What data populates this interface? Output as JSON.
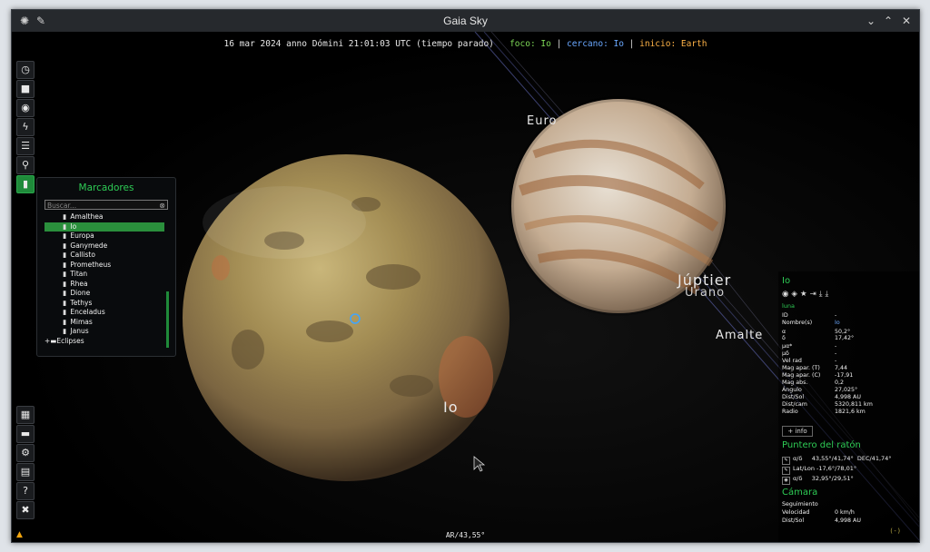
{
  "window": {
    "title": "Gaia Sky"
  },
  "topinfo": {
    "datetime": "16 mar 2024 anno Dómini 21:01:03 UTC (tiempo parado)",
    "focus_label": "foco: Io",
    "closest_label": "cercano: Io",
    "home_label": "inicio: Earth"
  },
  "toolbar": {
    "icons": [
      "clock-icon",
      "camera-icon",
      "eye-icon",
      "lightning-icon",
      "layers-icon",
      "location-pin-icon",
      "bookmark-icon"
    ],
    "bottom_icons": [
      "map-icon",
      "folder-icon",
      "gear-icon",
      "log-icon",
      "help-icon",
      "close-icon"
    ]
  },
  "bookmarks": {
    "title": "Marcadores",
    "search_placeholder": "Buscar...",
    "items": [
      "Amalthea",
      "Io",
      "Europa",
      "Ganymede",
      "Callisto",
      "Prometheus",
      "Titan",
      "Rhea",
      "Dione",
      "Tethys",
      "Enceladus",
      "Mimas",
      "Janus"
    ],
    "selected": "Io",
    "folder": "Eclipses"
  },
  "labels": {
    "io": "Io",
    "jupiter": "Júptier",
    "uranus": "Urano",
    "europa": "Euro",
    "amalthea": "Amalte"
  },
  "focus_panel": {
    "name": "Io",
    "type": "luna",
    "rows": [
      {
        "k": "ID",
        "v": "-"
      },
      {
        "k": "Nombre(s)",
        "v": "Io"
      },
      {
        "k": "α",
        "v": "50,2°"
      },
      {
        "k": "δ",
        "v": "17,42°"
      },
      {
        "k": "μα*",
        "v": "-"
      },
      {
        "k": "μδ",
        "v": "-"
      },
      {
        "k": "Vel rad",
        "v": "-"
      },
      {
        "k": "Mag apar. (T)",
        "v": "7,44"
      },
      {
        "k": "Mag apar. (C)",
        "v": "-17,91"
      },
      {
        "k": "Mag abs.",
        "v": "0,2"
      },
      {
        "k": "Ángulo",
        "v": "27,025°"
      },
      {
        "k": "Dist/Sol",
        "v": "4,998 AU"
      },
      {
        "k": "Dist/cam",
        "v": "5320,811 km"
      },
      {
        "k": "Radio",
        "v": "1821,6 km"
      }
    ],
    "more_info": "+ info"
  },
  "mouse": {
    "title": "Puntero del ratón",
    "rows": [
      {
        "label": "α/δ",
        "value": "43,55°/41,74°",
        "extra": "DEC/41,74°"
      },
      {
        "label": "Lat/Lon",
        "value": "-17,6°/78,01°",
        "extra": ""
      },
      {
        "label": "α/δ",
        "value": "32,95°/29,51°",
        "extra": ""
      }
    ]
  },
  "camera": {
    "title": "Cámara",
    "rows": [
      {
        "k": "Seguimiento",
        "v": ""
      },
      {
        "k": "Velocidad",
        "v": "0 km/h"
      },
      {
        "k": "Dist/Sol",
        "v": "4,998 AU"
      }
    ]
  },
  "status": {
    "bottom": "AR/43,55°",
    "corner": "(-)"
  },
  "colors": {
    "accent": "#2ecc55",
    "focus": "#7ed957",
    "closest": "#6aa8ff",
    "home": "#ffb347"
  }
}
